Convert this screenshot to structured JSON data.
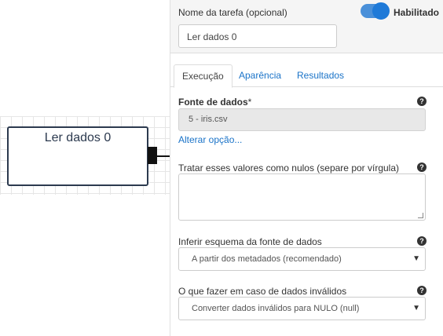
{
  "canvas": {
    "node_title": "Ler dados 0"
  },
  "header": {
    "task_name_label": "Nome da tarefa (opcional)",
    "task_name_value": "Ler dados 0",
    "toggle_label": "Habilitado"
  },
  "tabs": [
    {
      "label": "Execução",
      "active": true
    },
    {
      "label": "Aparência",
      "active": false
    },
    {
      "label": "Resultados",
      "active": false
    }
  ],
  "fields": {
    "source_label": "Fonte de dados",
    "source_required": "*",
    "source_value": "5 - iris.csv",
    "change_option": "Alterar opção...",
    "nulls_label": "Tratar esses valores como nulos (separe por vírgula)",
    "schema_label": "Inferir esquema da fonte de dados",
    "schema_value": "A partir dos metadados (recomendado)",
    "invalid_label": "O que fazer em caso de dados inválidos",
    "invalid_value": "Converter dados inválidos para NULO (null)"
  },
  "icons": {
    "help": "question-circle-icon",
    "caret": "caret-down-icon"
  },
  "colors": {
    "accent": "#1f7ad8",
    "link": "#1a73c8",
    "node_border": "#2c3a4f"
  }
}
